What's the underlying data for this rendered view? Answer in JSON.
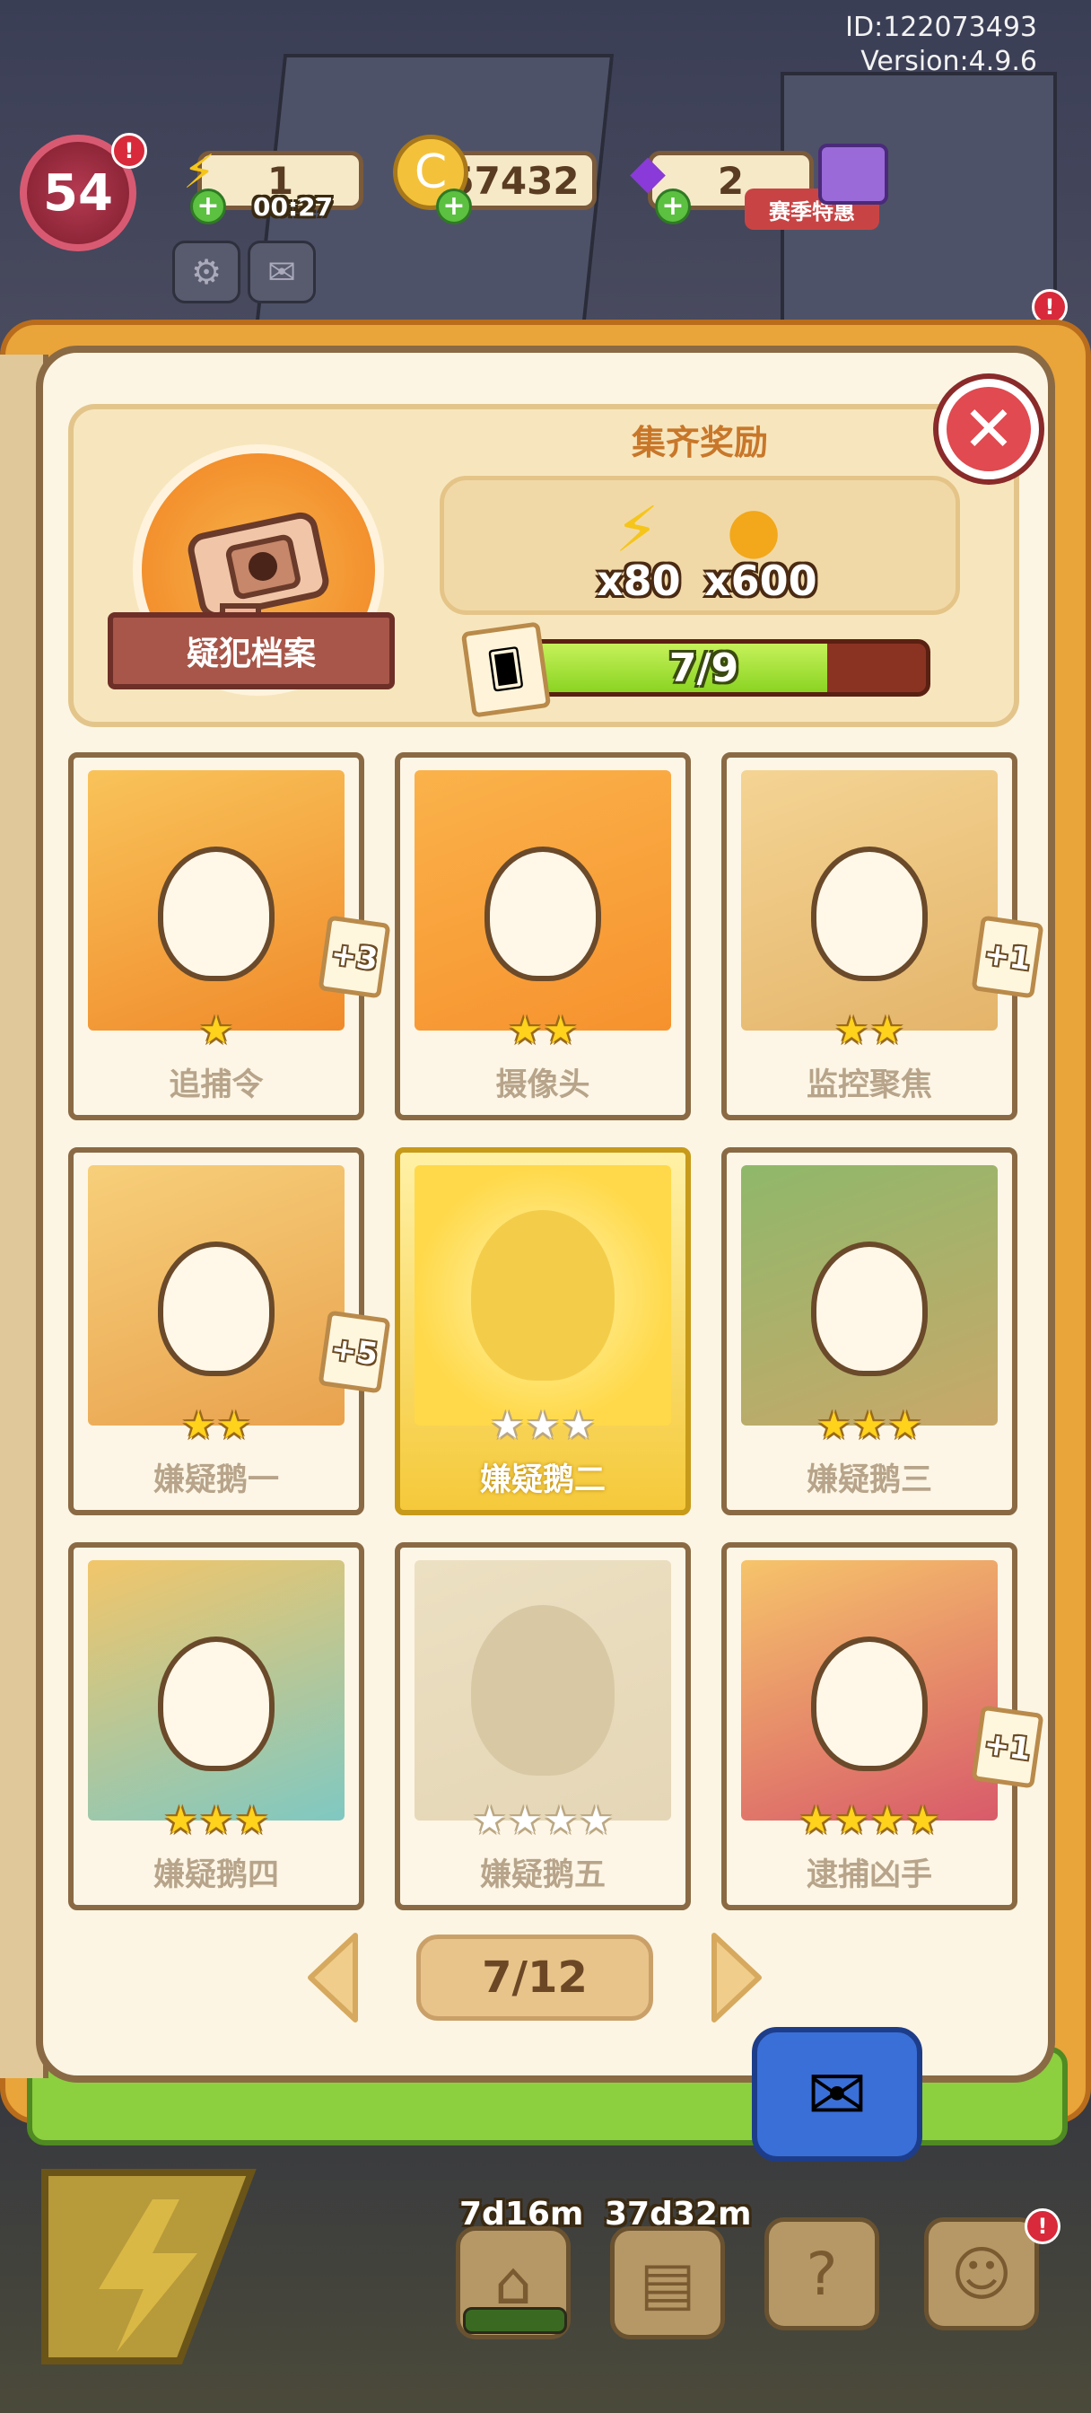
{
  "meta": {
    "player_id": "ID:122073493",
    "version": "Version:4.9.6"
  },
  "hud": {
    "level": "54",
    "energy": {
      "icon": "lightning-icon",
      "value": "1",
      "timer": "00:27"
    },
    "coins": {
      "icon": "coin-icon",
      "value": "57432"
    },
    "gems": {
      "icon": "gem-icon",
      "value": "2"
    },
    "promo_label": "赛季特惠",
    "settings_icon": "gear-icon",
    "mail_icon": "mail-icon"
  },
  "collection": {
    "title": "疑犯档案",
    "reward_title": "集齐奖励",
    "rewards": [
      {
        "icon": "lightning-icon",
        "qty": "x80"
      },
      {
        "icon": "coin-stack-icon",
        "qty": "x600"
      }
    ],
    "progress": {
      "text": "7/9",
      "collected": 7,
      "total": 9
    }
  },
  "cards": [
    {
      "name": "追捕令",
      "stars": 1,
      "max_stars": 1,
      "bonus": "+3",
      "state": "owned"
    },
    {
      "name": "摄像头",
      "stars": 2,
      "max_stars": 2,
      "bonus": "",
      "state": "owned"
    },
    {
      "name": "监控聚焦",
      "stars": 2,
      "max_stars": 2,
      "bonus": "+1",
      "state": "owned"
    },
    {
      "name": "嫌疑鹅一",
      "stars": 2,
      "max_stars": 2,
      "bonus": "+5",
      "state": "owned"
    },
    {
      "name": "嫌疑鹅二",
      "stars": 0,
      "max_stars": 3,
      "bonus": "",
      "state": "gold-locked"
    },
    {
      "name": "嫌疑鹅三",
      "stars": 3,
      "max_stars": 3,
      "bonus": "",
      "state": "owned"
    },
    {
      "name": "嫌疑鹅四",
      "stars": 3,
      "max_stars": 3,
      "bonus": "",
      "state": "owned"
    },
    {
      "name": "嫌疑鹅五",
      "stars": 0,
      "max_stars": 4,
      "bonus": "",
      "state": "locked"
    },
    {
      "name": "逮捕凶手",
      "stars": 4,
      "max_stars": 4,
      "bonus": "+1",
      "state": "owned"
    }
  ],
  "pager": {
    "text": "7/12"
  },
  "bottom": {
    "timer_1": "7d16m",
    "timer_2": "37d32m"
  },
  "colors": {
    "page_bg": "#fcf5e3",
    "book_orange": "#e9a43a",
    "progress_green": "#8ad422",
    "close_red": "#e04a50",
    "star_yellow": "#ffd21c"
  }
}
